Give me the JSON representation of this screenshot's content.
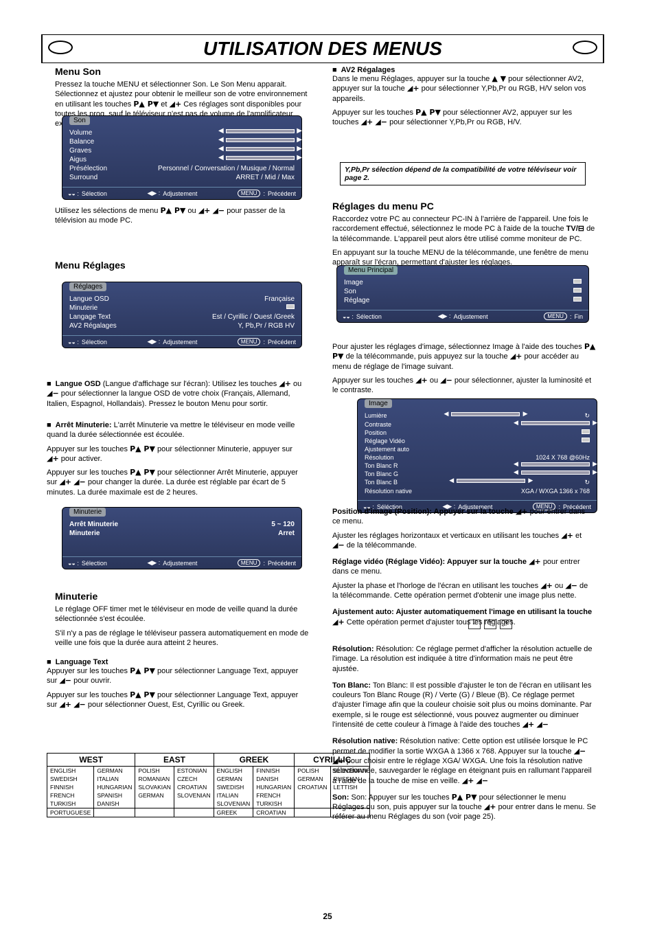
{
  "page": {
    "title": "UTILISATION DES MENUS",
    "number": "25"
  },
  "sec_son": {
    "heading": "Menu Son",
    "para1_prefix": "Pressez la touche MENU et sélectionner Son. Le Son Menu apparait. Sélectionnez et ajustez pour obtenir le meilleur son de votre environnement en utilisant les touches ",
    "para1_mid": " et ",
    "para1_suffix": " Ces réglages sont disponibles pour toutes les prog. sauf le téléviseur n'est pas de volume de l'amplificateur externe.",
    "para2_prefix": "Utilisez les sélections de menu ",
    "para2_mid1": " ou ",
    "para2_mid2": " pour passer de la télévision au mode PC.",
    "para2_suffix": ""
  },
  "osd_son": {
    "tab": "Son",
    "items": [
      "Volume",
      "Balance",
      "Graves",
      "Aigus"
    ],
    "preselection": "Personnel / Conversation / Musique / Normal",
    "surround": "ARRET / Mid / Max",
    "foot_sel": "Sélection",
    "foot_adj": "Adjustement",
    "foot_prev": "Précédent",
    "foot_menu": "MENU"
  },
  "osd_reglages": {
    "title": "Réglages",
    "r1l": "Langue OSD",
    "r1r": "Française",
    "r2l": "Minuterie",
    "r2r": "",
    "r3l": "Langage Text",
    "r3r": "Est / Cyrillic / Ouest /Greek",
    "r4l": "AV2 Régalages",
    "r4r": "Y, Pb,Pr / RGB HV",
    "foot_sel": "Sélection",
    "foot_adj": "Adjustement",
    "foot_prev": "Précédent",
    "foot_menu": "MENU"
  },
  "sec_reg": {
    "heading": "Menu Réglages",
    "bullet1_lbl": "Langue OSD",
    "bullet1_txt_prefix": " (Langue d'affichage sur l'écran): Utilisez les touches ",
    "bullet1_txt_mid": " ou ",
    "bullet1_txt_suffix": " pour sélectionner la langue OSD de votre choix (Français, Allemand, Italien, Espagnol, Hollandais). Pressez le bouton Menu pour sortir.",
    "bullet2_lbl": "Arrêt Minuterie:",
    "bullet2_txt": " L'arrêt Minuterie va mettre le téléviseur en mode veille quand la durée sélectionnée est écoulée.",
    "bullet2_p2_prefix": "Appuyer sur les touches ",
    "bullet2_p2_mid": " pour sélectionner Minuterie, appuyer sur ",
    "bullet2_p2_suffix": " pour activer.",
    "bullet2_p3_prefix": "Appuyer sur les touches ",
    "bullet2_p3_mid": " pour sélectionner Arrêt Minuterie, appuyer sur ",
    "bullet2_p3_suffix": " pour changer la durée. La durée est réglable par écart de 5 minutes. La durée maximale est de 2 heures."
  },
  "osd_min": {
    "tab": "Minuterie",
    "r1l": "Arrêt Minuterie",
    "r1r": "5 ~ 120",
    "r2l": "Minuterie",
    "r2r": "Arret",
    "foot_sel": "Sélection",
    "foot_adj": "Adjustement",
    "foot_prev": "Précédent",
    "foot_menu": "MENU"
  },
  "sec_min2": {
    "heading": "Minuterie",
    "para1": "Le réglage OFF timer met le téléviseur en mode de veille quand la durée sélectionnée s'est écoulée.",
    "para2": "S'il n'y a pas de réglage le téléviseur passera automatiquement en mode de veille une fois que la durée aura atteint 2 heures."
  },
  "sec_langtext": {
    "heading": "Language Text",
    "para_prefix": "Appuyer sur les touches ",
    "para_mid": " pour sélectionner Language Text, appuyer sur ",
    "para_mid2": " pour ouvrir.",
    "para2_prefix": "Appuyer sur les touches ",
    "para2_mid": " pour sélectionner Language Text, appuyer sur ",
    "para2_suffix": " pour sélectionner Ouest, Est, Cyrillic ou Greek."
  },
  "langtable": {
    "headers": [
      "WEST",
      "EAST",
      "GREEK",
      "CYRILLIC"
    ],
    "west": [
      [
        "ENGLISH",
        "GERMAN"
      ],
      [
        "SWEDISH",
        "ITALIAN"
      ],
      [
        "FINNISH",
        "HUNGARIAN"
      ],
      [
        "FRENCH",
        "SPANISH"
      ],
      [
        "TURKISH",
        "DANISH"
      ],
      [
        "PORTUGUESE",
        ""
      ]
    ],
    "east": [
      [
        "POLISH",
        "ESTONIAN"
      ],
      [
        "ROMANIAN",
        "CZECH"
      ],
      [
        "SLOVAKIAN",
        "CROATIAN"
      ],
      [
        "GERMAN",
        "SLOVENIAN"
      ]
    ],
    "greek": [
      [
        "ENGLISH",
        "FINNISH"
      ],
      [
        "GERMAN",
        "DANISH"
      ],
      [
        "SWEDISH",
        "HUNGARIAN"
      ],
      [
        "ITALIAN",
        "FRENCH"
      ],
      [
        "SLOVENIAN",
        "TURKISH"
      ],
      [
        "GREEK",
        "CROATIAN"
      ]
    ],
    "cyr": [
      [
        "POLISH",
        "SLOVENIAN"
      ],
      [
        "GERMAN",
        "RUSSIAN"
      ],
      [
        "CROATIAN",
        "LETTISH"
      ]
    ]
  },
  "right_av2": {
    "heading": "AV2 Régalages",
    "para1_prefix": "Dans le menu Réglages, appuyer sur la touche ",
    "para1_mid": " pour sélectionner AV2, appuyer sur la touche ",
    "para1_suffix": " pour sélectionner Y,Pb,Pr ou RGB, H/V selon vos appareils.",
    "para2_prefix": "Appuyer sur les touches ",
    "para2_mid": " pour sélectionner AV2, appuyer sur les touches ",
    "para2_suffix": " pour sélectionner Y,Pb,Pr ou RGB, H/V.",
    "box": "Y,Pb,Pr sélection dépend de la compatibilité de votre téléviseur voir page 2."
  },
  "right_pc": {
    "heading": "Réglages du menu PC",
    "para1_prefix": "Raccordez votre PC au connecteur PC-IN à l'arrière de l'appareil. Une fois le raccordement effectué, sélectionnez le mode PC à l'aide de la touche ",
    "para1_suffix": " de la télécommande. L'appareil peut alors être utilisé comme moniteur de PC.",
    "para2": "En appuyant sur la touche MENU de la télécommande, une fenêtre de menu apparaît sur l'écran, permettant d'ajuster les réglages.",
    "tv_label": "TV/"
  },
  "osd_main": {
    "tab": "Menu Principal",
    "items": [
      "Image",
      "Son",
      "Réglage"
    ],
    "foot_sel": "Sélection",
    "foot_adj": "Adjustement",
    "foot_fin": "Fin",
    "foot_menu": "MENU"
  },
  "right_image": {
    "para_prefix": "Pour ajuster les réglages d'image, sélectionnez Image à l'aide des touches ",
    "para_mid": " de la télécommande, puis appuyez sur la touche ",
    "para_suffix": " pour accéder au menu de réglage de l'image suivant.",
    "para2_prefix": "Appuyer sur les touches ",
    "para2_mid": " ou ",
    "para2_suffix": " pour sélectionner, ajuster la luminosité et le contraste."
  },
  "osd_image": {
    "tab": "Image",
    "rows": [
      {
        "l": "Lumière",
        "ctl": "bar"
      },
      {
        "l": "Contraste",
        "ctl": "bar"
      },
      {
        "l": "Position",
        "ctl": "enter"
      },
      {
        "l": "Réglage Vidéo",
        "ctl": "enter"
      },
      {
        "l": "Ajustement auto",
        "ctl": ""
      },
      {
        "l": "Résolution",
        "r": "1024 X 768    @60Hz"
      },
      {
        "l": "Ton Blanc R",
        "ctl": "bar"
      },
      {
        "l": "Ton Blanc G",
        "ctl": "bar"
      },
      {
        "l": "Ton Blanc B",
        "ctl": "bar"
      },
      {
        "l": "Résolution native",
        "r": "XGA / WXGA 1366 x 768"
      }
    ],
    "foot_sel": "Séléction",
    "foot_adj": "Adjustement",
    "foot_prev": "Précédent",
    "foot_menu": "MENU"
  },
  "right_pos": {
    "p1_prefix": "Position d'image (Position): Appuyer sur la touche ",
    "p1_suffix": " pour entrer dans ce menu.",
    "p2_prefix": "Ajuster les réglages horizontaux et verticaux en utilisant les touches ",
    "p2_mid": " et ",
    "p2_suffix": " de la télécommande.",
    "p3_prefix": "Réglage vidéo (Réglage Vidéo): Appuyer sur la touche ",
    "p3_suffix": " pour entrer dans ce menu.",
    "p4_prefix": "Ajuster la phase et l'horloge de l'écran en utilisant les touches ",
    "p4_mid": " ou ",
    "p4_suffix": " de la télécommande. Cette opération permet d'obtenir une image plus nette.",
    "p5_prefix": "Ajustement auto: Ajuster automatiquement l'image en utilisant la touche ",
    "p5_suffix": " Cette opération permet d'ajuster tous les réglages."
  },
  "tinyicons": {
    "a": "−",
    "b": "T",
    "c": "?"
  },
  "right_reso": {
    "p1": "Résolution: Ce réglage permet d'afficher la résolution actuelle de l'image. La résolution est indiquée à titre d'information mais ne peut être ajustée.",
    "p2_prefix": "Ton Blanc: Il est possible d'ajuster le ton de l'écran en utilisant les couleurs Ton Blanc Rouge (R) / Verte (G) / Bleue (B). Ce réglage permet d'ajuster l'image afin que la couleur choisie soit plus ou moins dominante. Par exemple, si le rouge est sélectionné, vous pouvez augmenter ou diminuer l'intensité de cette couleur à l'image à l'aide des touches ",
    "p2_suffix": "",
    "p3_prefix": "Résolution native: Cette option est utilisée lorsque le PC permet de modifier la sortie WXGA à 1366 x 768. Appuyer sur la touche ",
    "p3_mid": " pour choisir entre le réglage XGA/ WXGA. Une fois la résolution native sélectionnée, sauvegarder le réglage en éteignant puis en rallumant l'appareil à l'aide de la touche de mise en veille.",
    "p4_prefix": "Son: Appuyer sur les touches ",
    "p4_mid": " pour sélectionner le menu Réglages du son, puis appuyer sur la touche ",
    "p4_suffix": " pour entrer dans le menu. Se référer au menu Réglages du son (voir page 25)."
  }
}
